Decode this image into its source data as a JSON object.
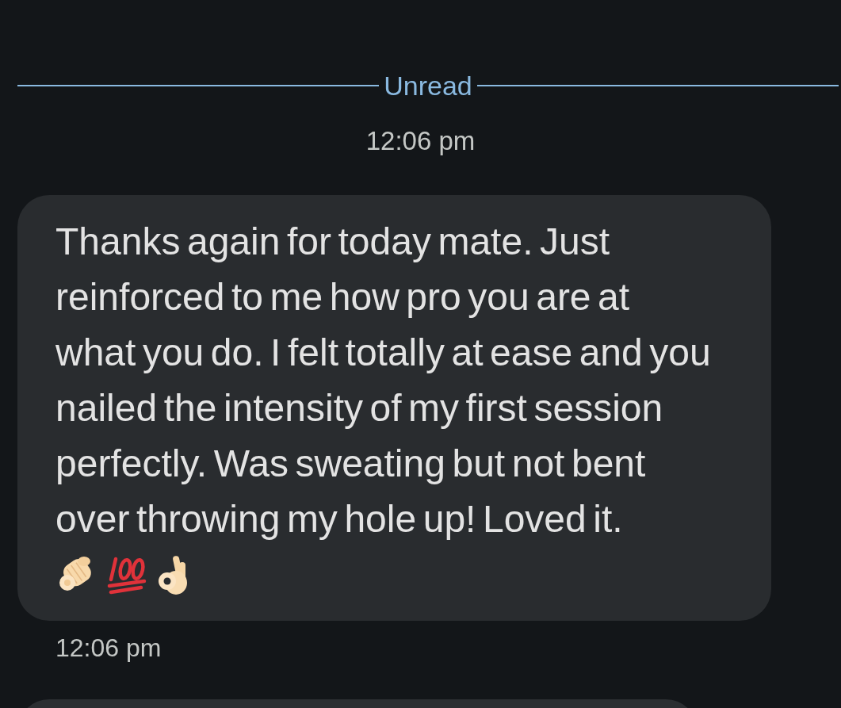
{
  "unread_divider": {
    "label": "Unread"
  },
  "date_stamp": "12:06 pm",
  "messages": [
    {
      "clipped": false,
      "text": "Thanks again for today mate. Just reinforced to me how pro you are at what you do. I felt totally at ease and you nailed the intensity of my first session perfectly. Was sweating but not bent over throwing my hole up! Loved it.",
      "emoji_line": [
        {
          "kind": "pointing_hand"
        },
        {
          "kind": "hundred_points"
        },
        {
          "kind": "ok_hand"
        }
      ],
      "time": "12:06 pm"
    },
    {
      "clipped": true
    }
  ]
}
